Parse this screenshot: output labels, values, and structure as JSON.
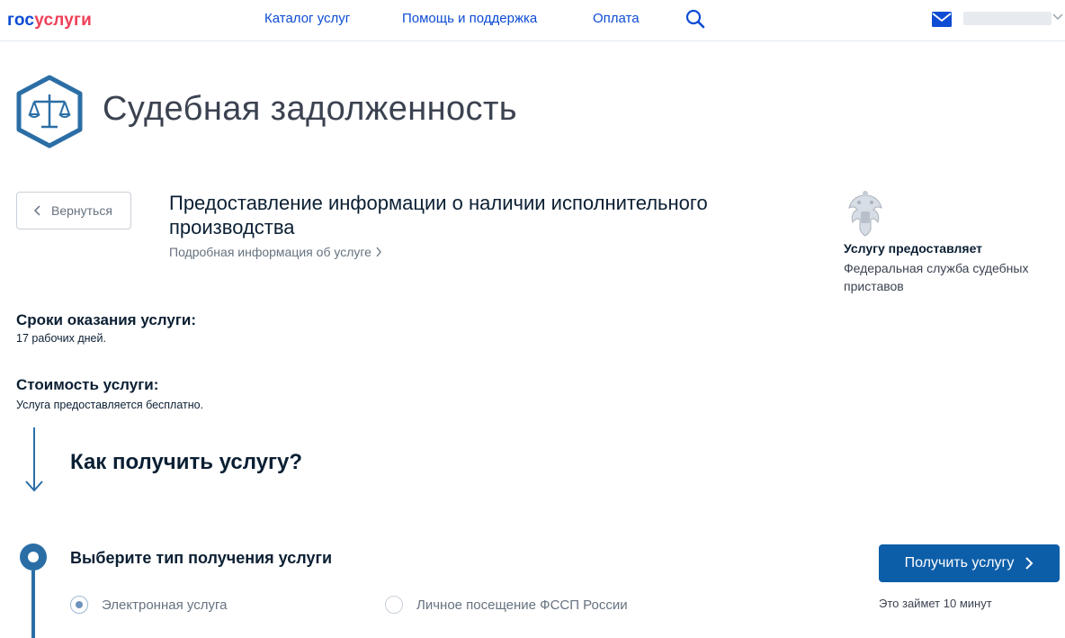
{
  "header": {
    "logo_part1": "гос",
    "logo_part2": "услуги",
    "nav": [
      "Каталог услуг",
      "Помощь и поддержка",
      "Оплата"
    ]
  },
  "page": {
    "title": "Судебная задолженность"
  },
  "back_button": "Вернуться",
  "service": {
    "heading": "Предоставление информации о наличии исполнительного производства",
    "details_link": "Подробная информация об услуге"
  },
  "provider": {
    "label": "Услугу предоставляет",
    "name": "Федеральная служба судебных приставов"
  },
  "terms": {
    "label": "Сроки оказания услуги:",
    "value": "17 рабочих дней."
  },
  "cost": {
    "label": "Стоимость услуги:",
    "value": "Услуга предоставляется бесплатно."
  },
  "how": {
    "title": "Как получить услугу?",
    "step_title": "Выберите тип получения услуги",
    "options": [
      {
        "label": "Электронная услуга",
        "selected": true
      },
      {
        "label": "Личное посещение ФССП России",
        "selected": false
      }
    ]
  },
  "cta": {
    "button": "Получить услугу",
    "time_note": "Это займет 10 минут"
  },
  "colors": {
    "brand_blue": "#0d4cd3",
    "brand_red": "#ee3f58",
    "cta_blue": "#0d5ea8",
    "step_blue": "#2b6ea6"
  }
}
